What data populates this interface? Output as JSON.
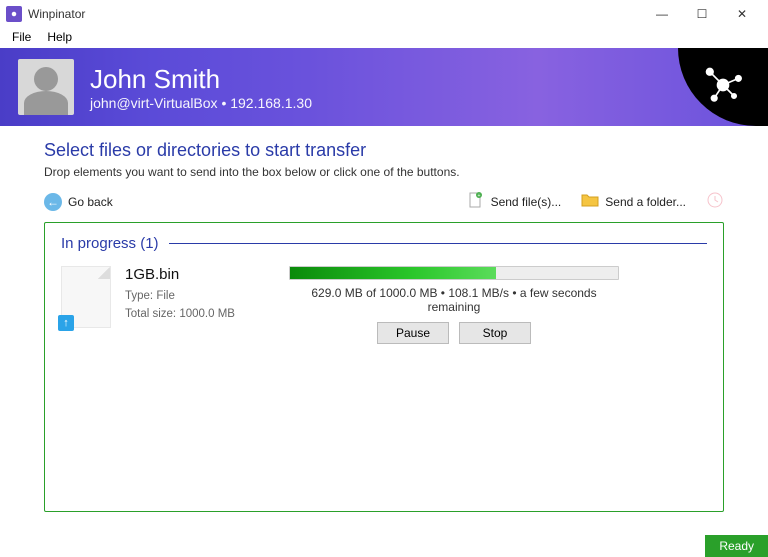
{
  "app": {
    "title": "Winpinator"
  },
  "menu": {
    "file": "File",
    "help": "Help"
  },
  "user": {
    "name": "John Smith",
    "identity": "john@virt-VirtualBox • 192.168.1.30"
  },
  "page": {
    "heading": "Select files or directories to start transfer",
    "subheading": "Drop elements you want to send into the box below or click one of the buttons."
  },
  "actions": {
    "back": "Go back",
    "send_files": "Send file(s)...",
    "send_folder": "Send a folder..."
  },
  "panel": {
    "title": "In progress (1)"
  },
  "transfer": {
    "filename": "1GB.bin",
    "type_label": "Type:",
    "type_value": "File",
    "size_label": "Total size:",
    "size_value": "1000.0 MB",
    "progress_percent": 62.9,
    "progress_text": "629.0 MB of 1000.0 MB • 108.1 MB/s • a few seconds remaining",
    "pause": "Pause",
    "stop": "Stop"
  },
  "status": {
    "ready": "Ready"
  }
}
